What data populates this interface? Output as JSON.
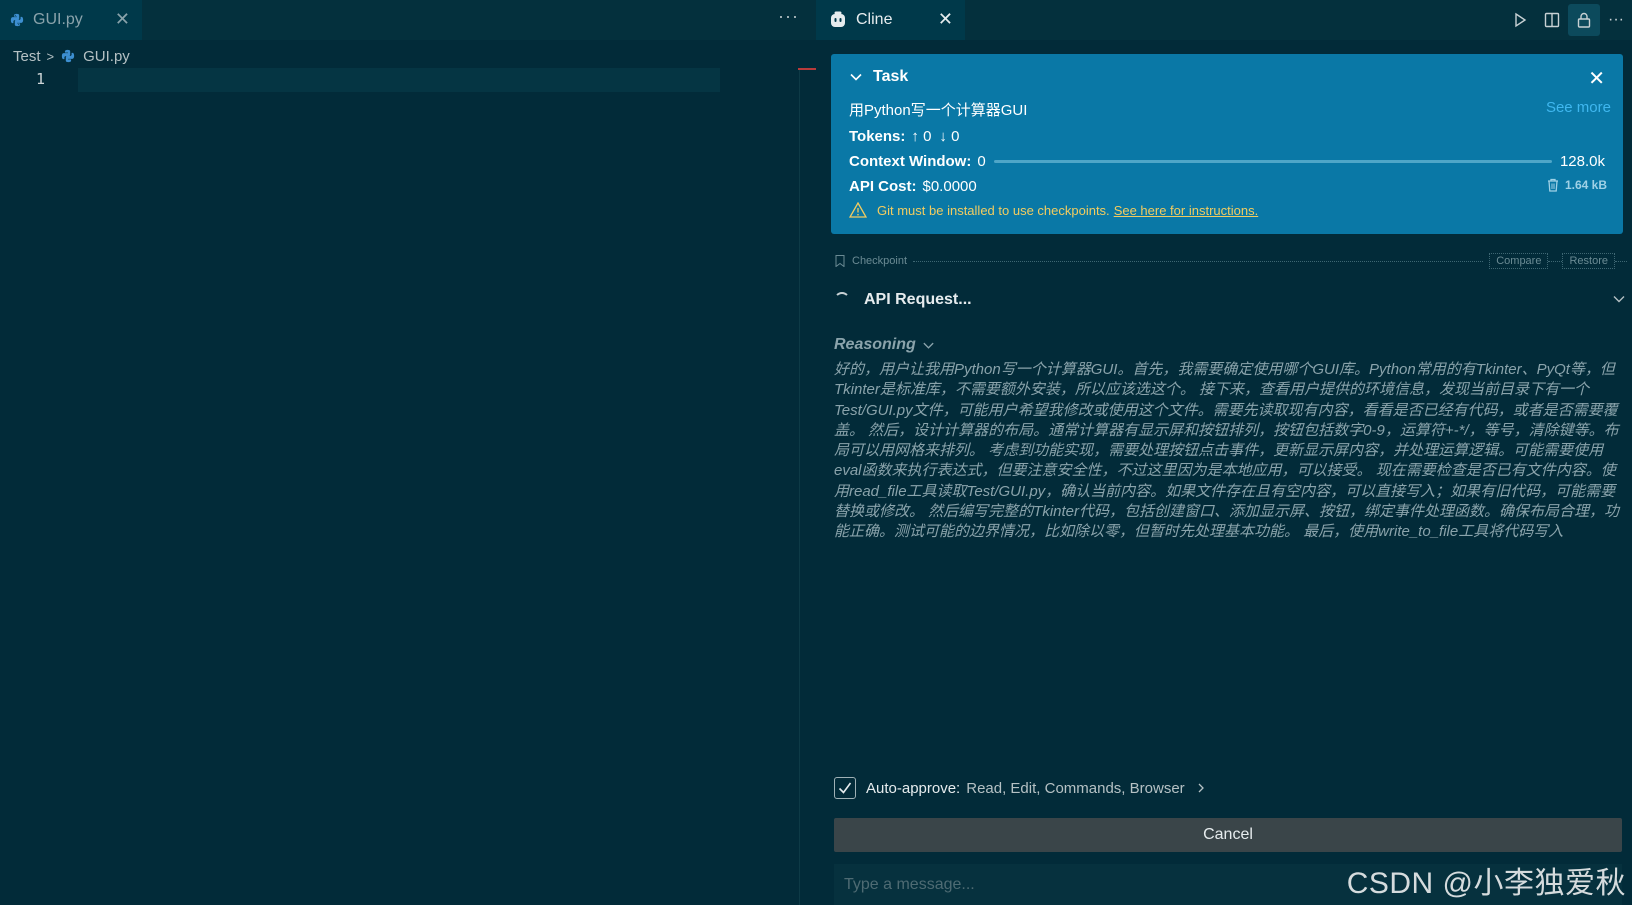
{
  "editor": {
    "tab_label": "GUI.py",
    "tab_close": "✕",
    "more": "···",
    "breadcrumb": {
      "folder": "Test",
      "separator": ">",
      "file": "GUI.py"
    },
    "line_number": "1"
  },
  "panel": {
    "tab_label": "Cline",
    "tab_close": "✕",
    "toolbar_icons": [
      "run-icon",
      "split-editor-icon",
      "lock-icon",
      "more-icon"
    ],
    "more": "···",
    "task": {
      "header": "Task",
      "close": "✕",
      "text": "用Python写一个计算器GUI",
      "see_more": "See more",
      "tokens_label": "Tokens:",
      "tokens_up": "↑ 0",
      "tokens_down": "↓ 0",
      "context_label": "Context Window:",
      "context_used": "0",
      "context_max": "128.0k",
      "context_fraction": 0.0,
      "api_cost_label": "API Cost:",
      "api_cost_value": "$0.0000",
      "size": "1.64 kB",
      "warning_text": "Git must be installed to use checkpoints.",
      "warning_link": "See here for instructions."
    },
    "checkpoint": {
      "label": "Checkpoint",
      "compare": "Compare",
      "restore": "Restore"
    },
    "api_request": "API Request...",
    "reasoning_label": "Reasoning",
    "reasoning_text": "好的，用户让我用Python写一个计算器GUI。首先，我需要确定使用哪个GUI库。Python常用的有Tkinter、PyQt等，但Tkinter是标准库，不需要额外安装，所以应该选这个。 接下来，查看用户提供的环境信息，发现当前目录下有一个Test/GUI.py文件，可能用户希望我修改或使用这个文件。需要先读取现有内容，看看是否已经有代码，或者是否需要覆盖。 然后，设计计算器的布局。通常计算器有显示屏和按钮排列，按钮包括数字0-9，运算符+-*/，等号，清除键等。布局可以用网格来排列。 考虑到功能实现，需要处理按钮点击事件，更新显示屏内容，并处理运算逻辑。可能需要使用eval函数来执行表达式，但要注意安全性，不过这里因为是本地应用，可以接受。 现在需要检查是否已有文件内容。使用read_file工具读取Test/GUI.py，确认当前内容。如果文件存在且有空内容，可以直接写入；如果有旧代码，可能需要替换或修改。 然后编写完整的Tkinter代码，包括创建窗口、添加显示屏、按钮，绑定事件处理函数。确保布局合理，功能正确。测试可能的边界情况，比如除以零，但暂时先处理基本功能。 最后，使用write_to_file工具将代码写入",
    "auto_approve": {
      "checked": true,
      "label": "Auto-approve:",
      "values": "Read, Edit, Commands, Browser"
    },
    "cancel": "Cancel",
    "message_placeholder": "Type a message..."
  },
  "watermark": "CSDN @小李独爱秋",
  "colors": {
    "background": "#022b39",
    "task_card": "#0a78a6",
    "warning": "#f2cc60",
    "link": "#3fb7ef"
  }
}
